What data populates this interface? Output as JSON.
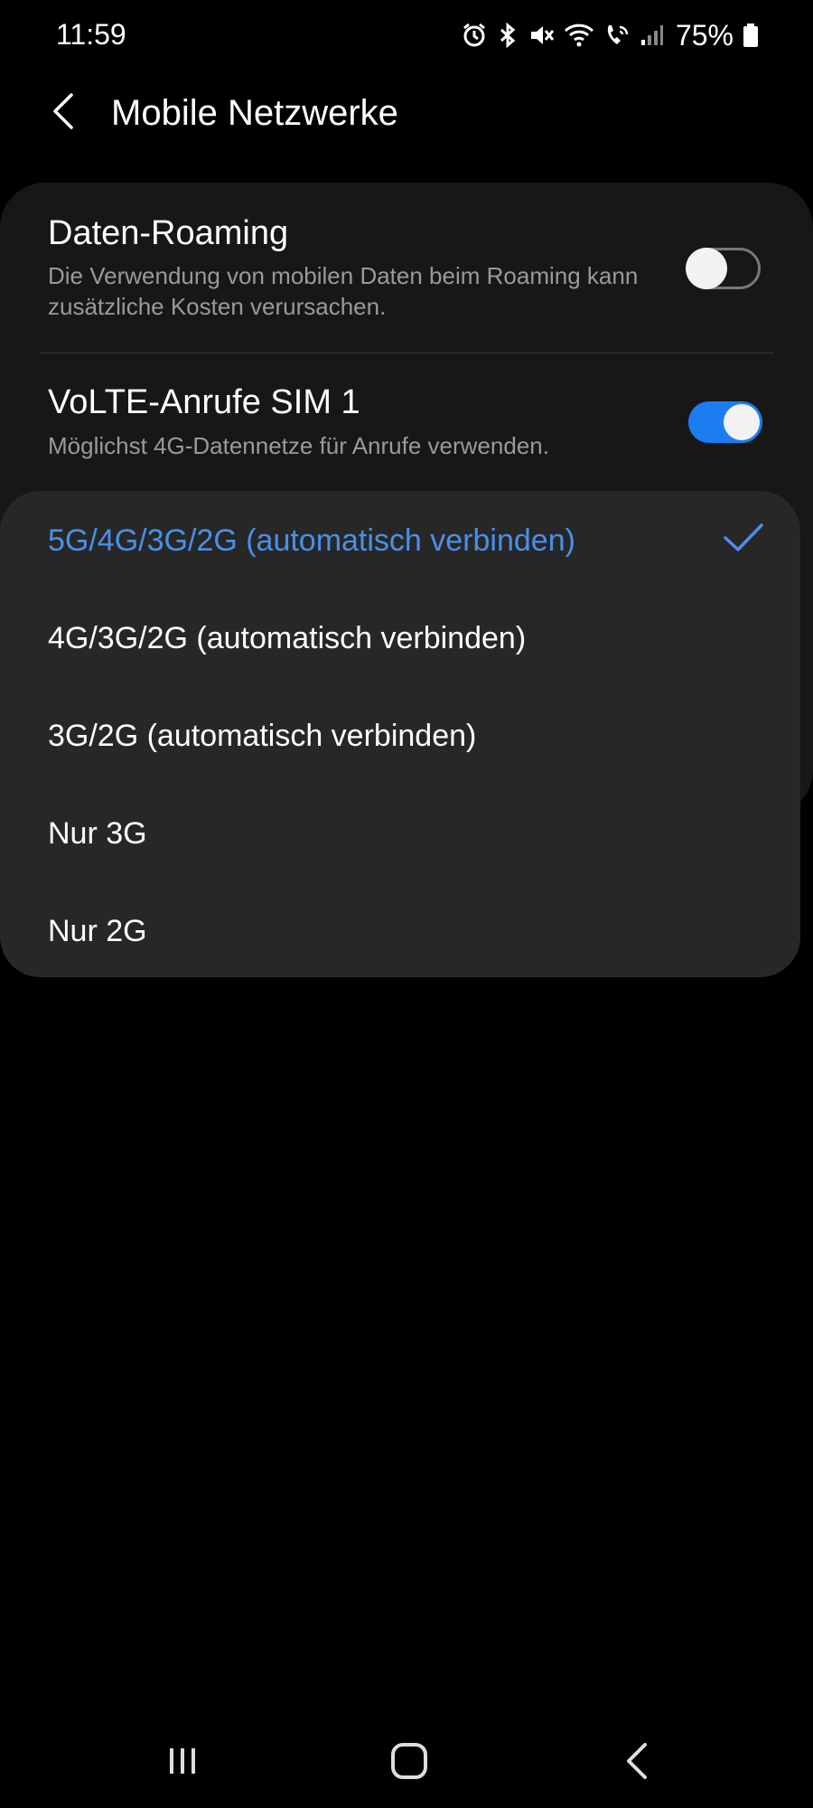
{
  "status_bar": {
    "time": "11:59",
    "battery": "75%",
    "icons": [
      "alarm-icon",
      "bluetooth-icon",
      "mute-icon",
      "wifi-icon",
      "wifi-call-icon",
      "signal-icon",
      "battery-icon"
    ]
  },
  "header": {
    "title": "Mobile Netzwerke",
    "back_icon": "chevron-left-icon"
  },
  "settings": {
    "roaming": {
      "title": "Daten-Roaming",
      "description": "Die Verwendung von mobilen Daten beim Roaming kann zusätzliche Kosten verursachen.",
      "enabled": false
    },
    "volte": {
      "title": "VoLTE-Anrufe SIM 1",
      "description": "Möglichst 4G-Datennetze für Anrufe verwenden.",
      "enabled": true
    }
  },
  "network_mode_popup": {
    "options": [
      {
        "label": "5G/4G/3G/2G (automatisch verbinden)",
        "selected": true
      },
      {
        "label": "4G/3G/2G (automatisch verbinden)",
        "selected": false
      },
      {
        "label": "3G/2G (automatisch verbinden)",
        "selected": false
      },
      {
        "label": "Nur 3G",
        "selected": false
      },
      {
        "label": "Nur 2G",
        "selected": false
      }
    ]
  },
  "navbar": {
    "icons": [
      "recent-apps-icon",
      "home-icon",
      "back-icon"
    ]
  },
  "colors": {
    "accent": "#1b7df0",
    "selected_text": "#4a90e8",
    "background": "#000000",
    "card": "#171717",
    "popup": "#272728"
  }
}
